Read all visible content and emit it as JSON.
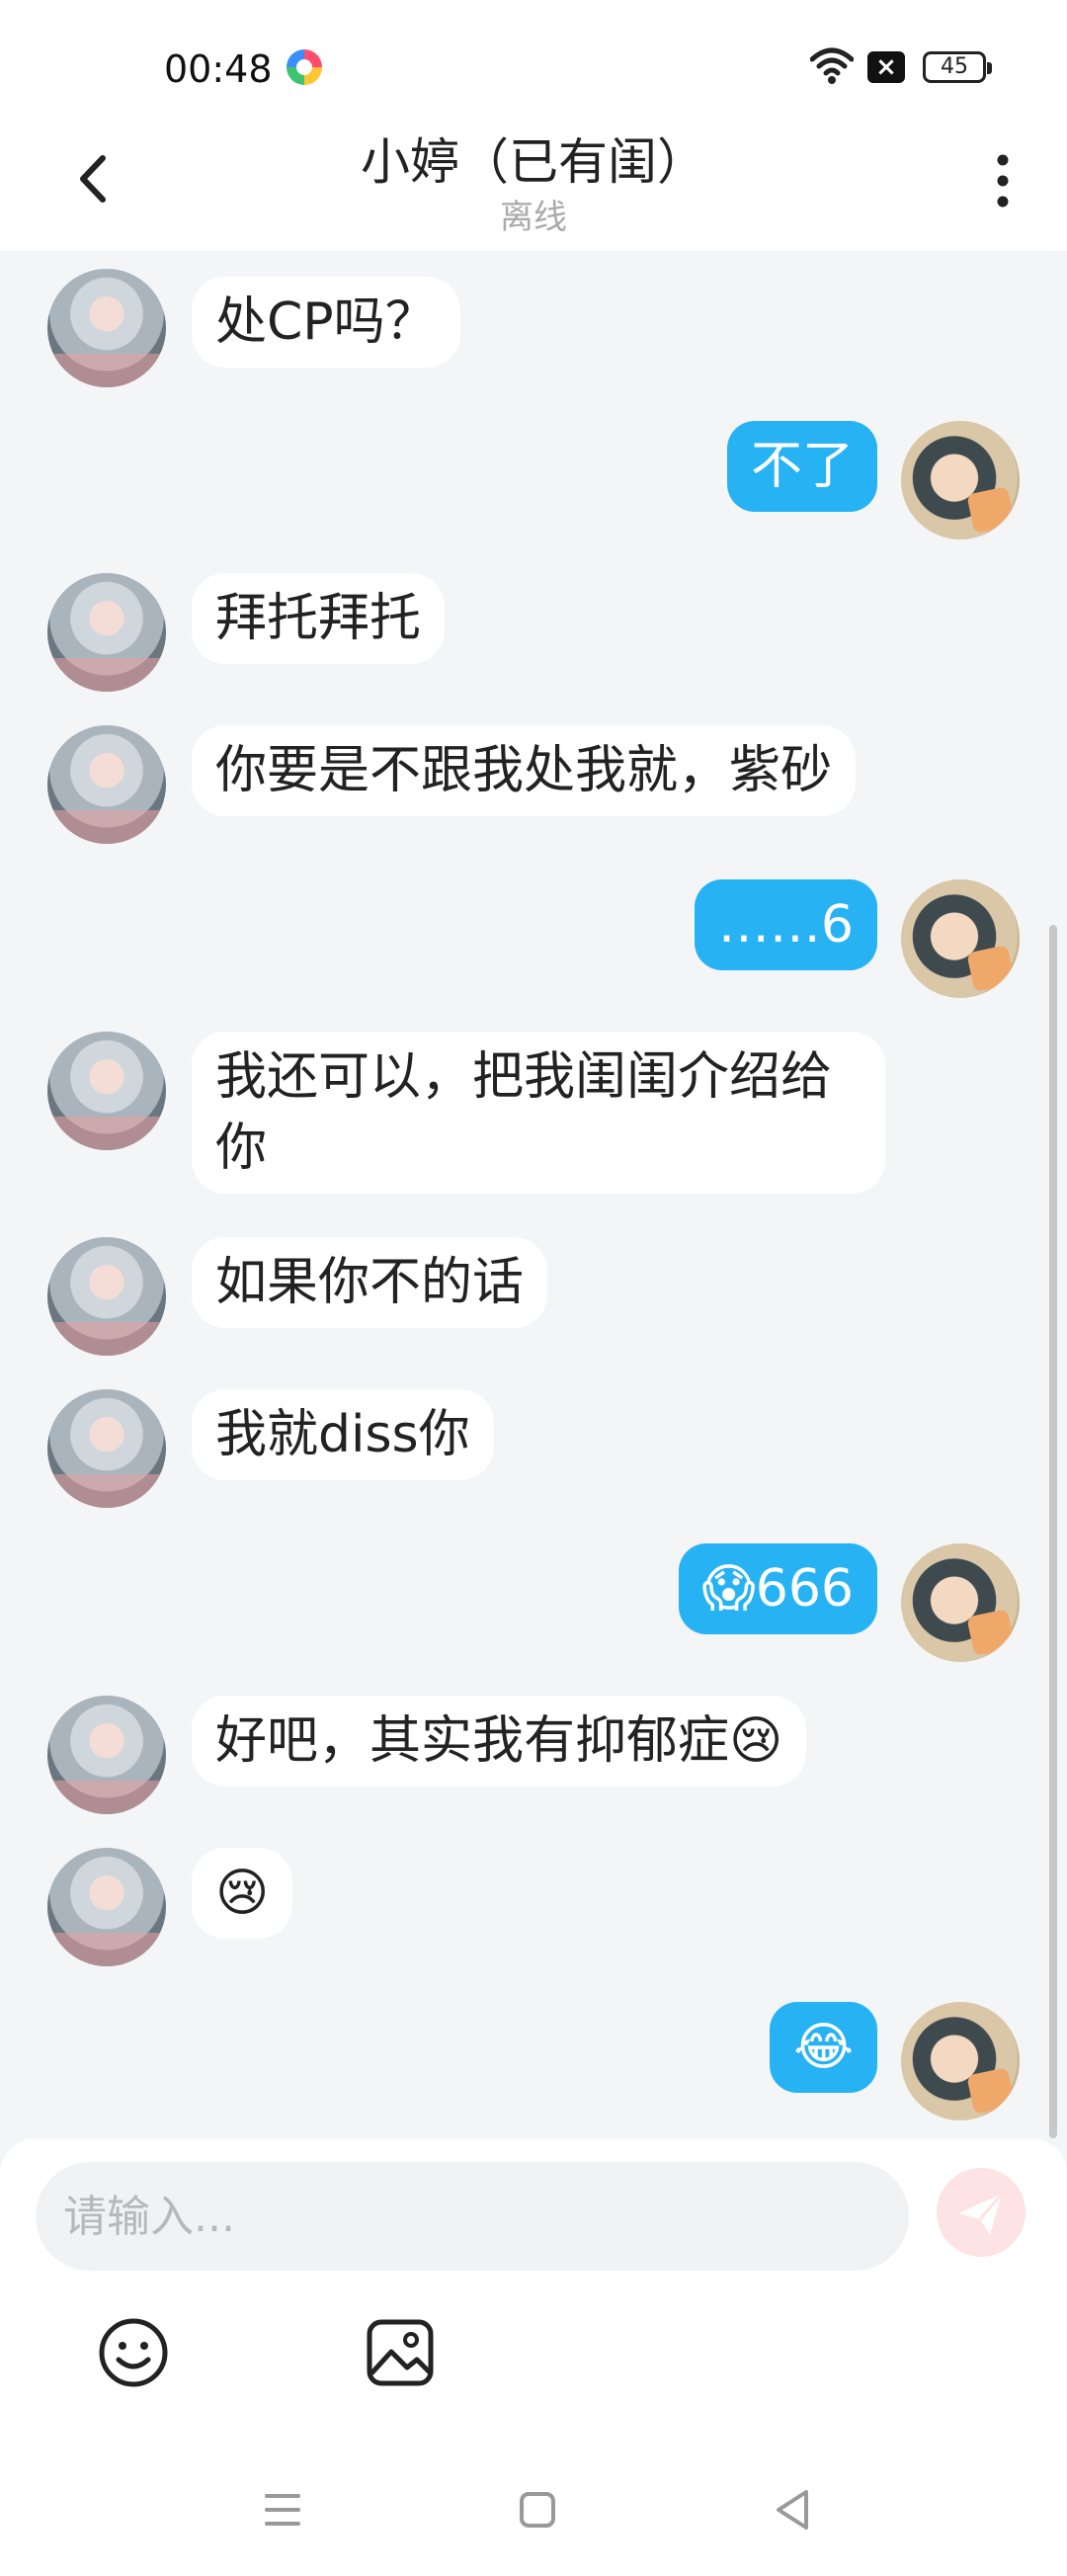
{
  "status_bar": {
    "time": "00:48",
    "battery": "45",
    "icons": [
      "app-notification-icon",
      "wifi-icon",
      "sim-disabled-icon",
      "battery-icon"
    ]
  },
  "header": {
    "title": "小婷（已有闺）",
    "subtitle": "离线",
    "back_icon": "chevron-left-icon",
    "more_icon": "more-vertical-icon"
  },
  "messages": [
    {
      "side": "in",
      "text": "处CP吗？"
    },
    {
      "side": "out",
      "text": "不了"
    },
    {
      "side": "in",
      "text": "拜托拜托"
    },
    {
      "side": "in",
      "text": "你要是不跟我处我就，紫砂"
    },
    {
      "side": "out",
      "text": "……6"
    },
    {
      "side": "in",
      "text": "我还可以，把我闺闺介绍给你"
    },
    {
      "side": "in",
      "text": "如果你不的话"
    },
    {
      "side": "in",
      "text": "我就diss你"
    },
    {
      "side": "out",
      "text": "😱666"
    },
    {
      "side": "in",
      "text": "好吧，其实我有抑郁症😢"
    },
    {
      "side": "in",
      "text": "😢"
    },
    {
      "side": "out",
      "text": "😂"
    }
  ],
  "composer": {
    "placeholder": "请输入...",
    "value": "",
    "send_icon": "send-icon",
    "emoji_icon": "emoji-icon",
    "image_icon": "image-icon"
  },
  "nav_bar": {
    "icons": [
      "menu-icon",
      "home-icon",
      "back-triangle-icon"
    ]
  },
  "colors": {
    "background": "#f4f5f7",
    "outgoing_bubble": "#27b3f3",
    "incoming_bubble": "#ffffff",
    "send_button": "#fde3e3"
  }
}
